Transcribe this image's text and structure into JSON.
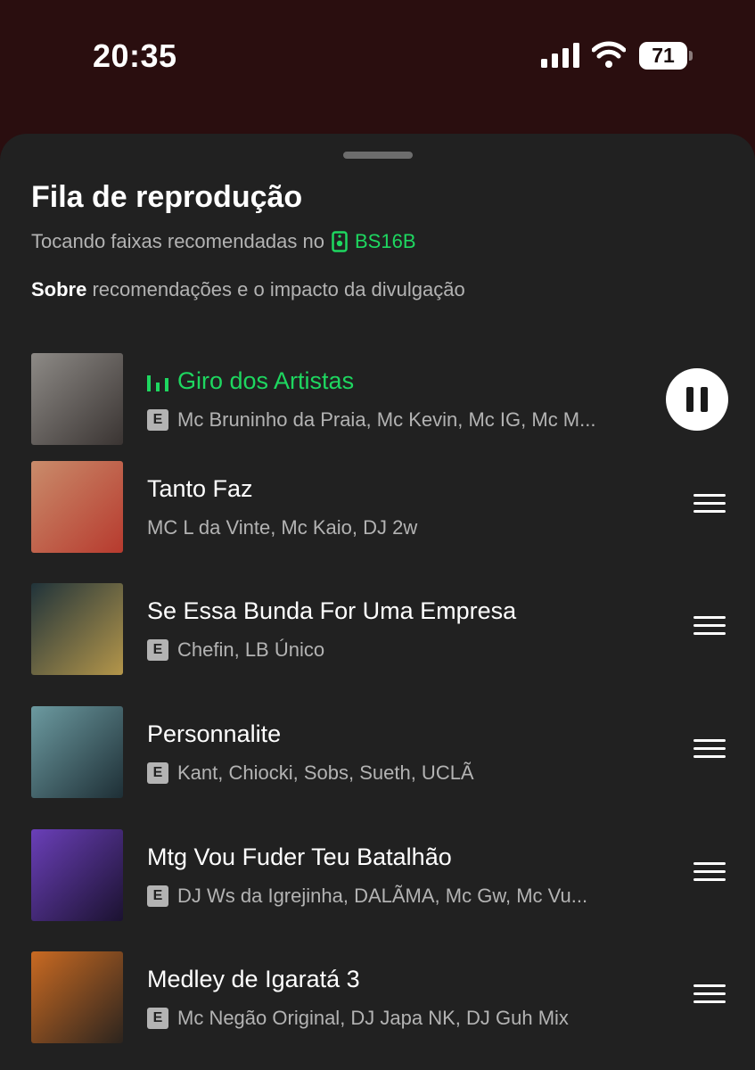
{
  "status_bar": {
    "time": "20:35",
    "battery": "71"
  },
  "queue": {
    "title": "Fila de reprodução",
    "subtitle_prefix": "Tocando faixas recomendadas no",
    "device_name": "BS16B",
    "about_bold": "Sobre",
    "about_rest": " recomendações e o impacto da divulgação"
  },
  "tracks": [
    {
      "title": "Giro dos Artistas",
      "artists": "Mc Bruninho da Praia, Mc Kevin, Mc IG, Mc M...",
      "explicit": true,
      "playing": true,
      "cover_colors": [
        "#8d8a86",
        "#3a3432"
      ]
    },
    {
      "title": "Tanto Faz",
      "artists": "MC L da Vinte, Mc Kaio, DJ 2w",
      "explicit": false,
      "playing": false,
      "cover_colors": [
        "#c98c6b",
        "#b73a2e"
      ]
    },
    {
      "title": "Se Essa Bunda For Uma Empresa",
      "artists": "Chefin, LB Único",
      "explicit": true,
      "playing": false,
      "cover_colors": [
        "#20333a",
        "#b4964a"
      ]
    },
    {
      "title": "Personnalite",
      "artists": "Kant, Chiocki, Sobs, Sueth, UCLÃ",
      "explicit": true,
      "playing": false,
      "cover_colors": [
        "#6c9aa0",
        "#1e2f36"
      ]
    },
    {
      "title": "Mtg Vou Fuder Teu Batalhão",
      "artists": "DJ Ws da Igrejinha, DALÃMA, Mc Gw, Mc Vu...",
      "explicit": true,
      "playing": false,
      "cover_colors": [
        "#6a3fb8",
        "#1b1230"
      ]
    },
    {
      "title": "Medley de Igaratá 3",
      "artists": "Mc Negão Original, DJ Japa NK, DJ Guh Mix",
      "explicit": true,
      "playing": false,
      "cover_colors": [
        "#c96a22",
        "#2c241e"
      ]
    }
  ],
  "labels": {
    "explicit_badge": "E"
  },
  "colors": {
    "accent": "#1ed760",
    "sheet_bg": "#212121",
    "top_bg": "#2a0e0f"
  }
}
